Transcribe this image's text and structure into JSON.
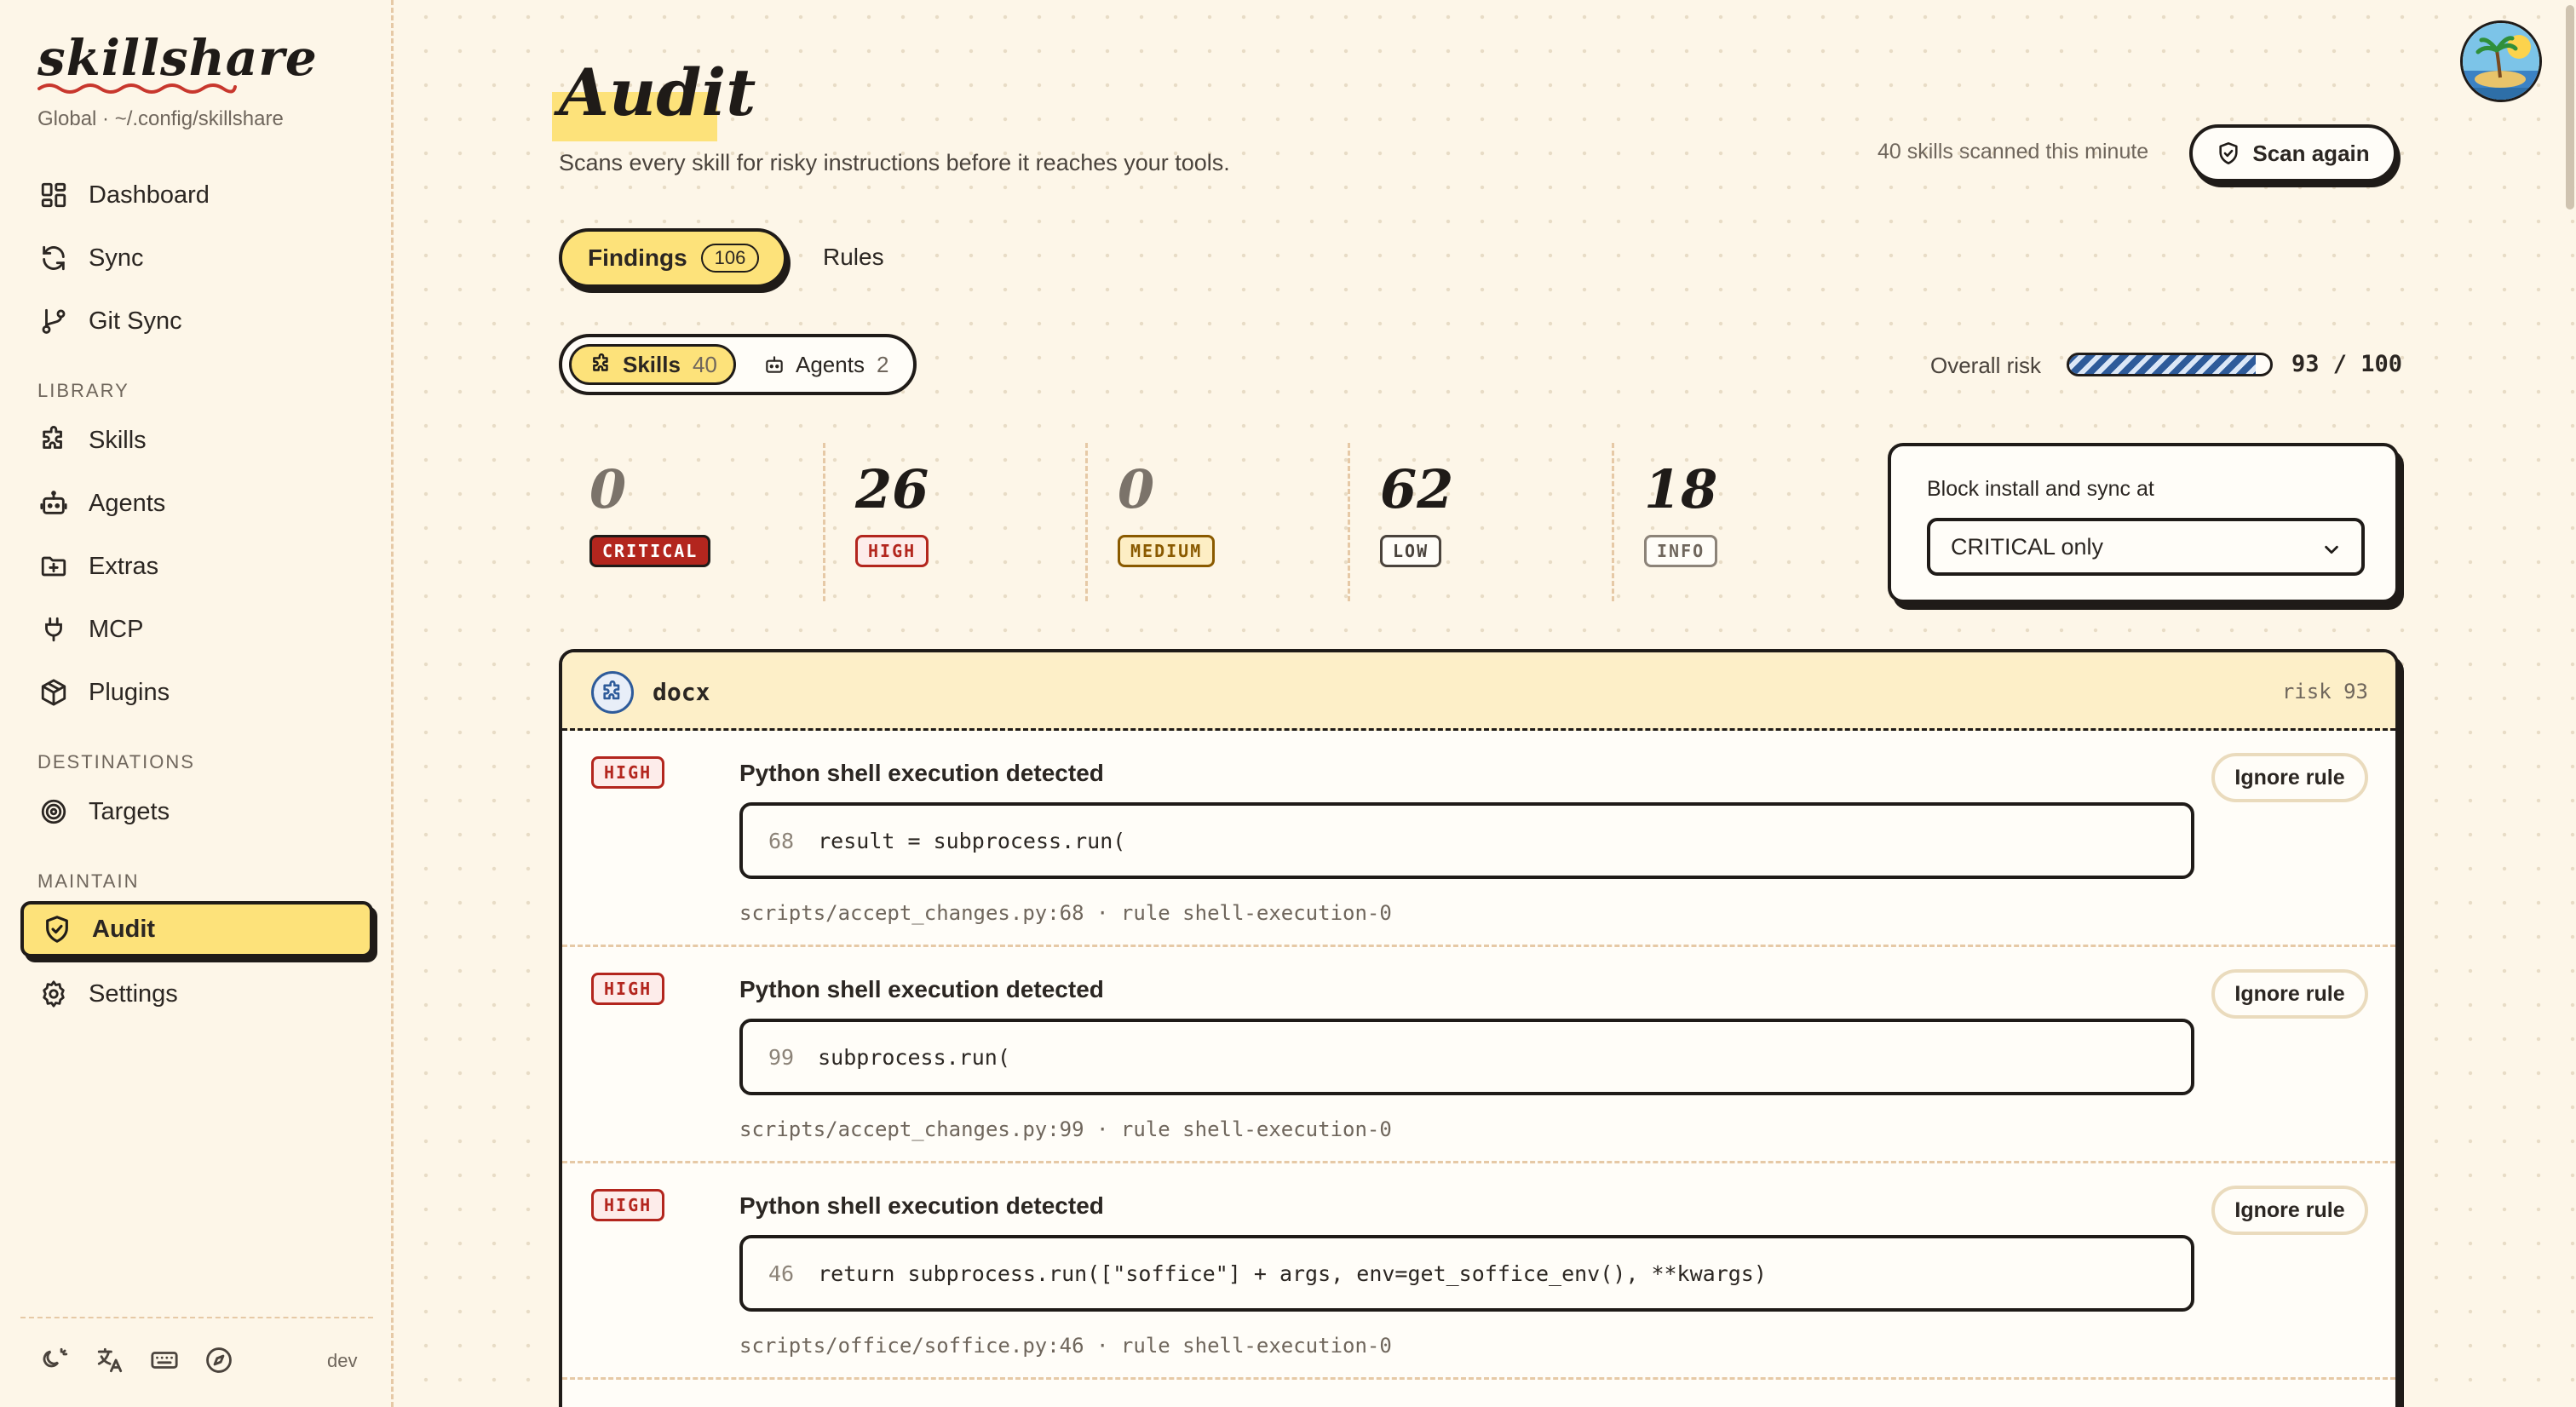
{
  "brand": {
    "name": "skillshare",
    "scope": "Global · ~/.config/skillshare"
  },
  "nav": {
    "dashboard": "Dashboard",
    "sync": "Sync",
    "git_sync": "Git Sync",
    "library_label": "LIBRARY",
    "skills": "Skills",
    "agents": "Agents",
    "extras": "Extras",
    "mcp": "MCP",
    "plugins": "Plugins",
    "destinations_label": "DESTINATIONS",
    "targets": "Targets",
    "maintain_label": "MAINTAIN",
    "audit": "Audit",
    "settings": "Settings",
    "active": "Audit"
  },
  "footer": {
    "env": "dev",
    "icons": [
      "theme-icon",
      "translate-icon",
      "keyboard-icon",
      "compass-icon"
    ]
  },
  "page": {
    "title": "Audit",
    "subtitle": "Scans every skill for risky instructions before it reaches your tools.",
    "scan_meta": "40 skills scanned this minute",
    "scan_button": "Scan again"
  },
  "tabs": {
    "findings": {
      "label": "Findings",
      "count": "106"
    },
    "rules": {
      "label": "Rules"
    }
  },
  "segment": {
    "skills": {
      "label": "Skills",
      "count": "40"
    },
    "agents": {
      "label": "Agents",
      "count": "2"
    }
  },
  "risk": {
    "label": "Overall risk",
    "value": 93,
    "max": 100,
    "text": "93 / 100"
  },
  "stats": [
    {
      "count": "0",
      "label": "CRITICAL"
    },
    {
      "count": "26",
      "label": "HIGH"
    },
    {
      "count": "0",
      "label": "MEDIUM"
    },
    {
      "count": "62",
      "label": "LOW"
    },
    {
      "count": "18",
      "label": "INFO"
    }
  ],
  "block": {
    "label": "Block install and sync at",
    "value": "CRITICAL only"
  },
  "group": {
    "name": "docx",
    "risk": "risk 93"
  },
  "findings": [
    {
      "severity": "HIGH",
      "title": "Python shell execution detected",
      "line": "68",
      "code": "result = subprocess.run(",
      "location": "scripts/accept_changes.py:68 · rule shell-execution-0",
      "action": "Ignore rule"
    },
    {
      "severity": "HIGH",
      "title": "Python shell execution detected",
      "line": "99",
      "code": "subprocess.run(",
      "location": "scripts/accept_changes.py:99 · rule shell-execution-0",
      "action": "Ignore rule"
    },
    {
      "severity": "HIGH",
      "title": "Python shell execution detected",
      "line": "46",
      "code": "return subprocess.run([\"soffice\"] + args, env=get_soffice_env(), **kwargs)",
      "location": "scripts/office/soffice.py:46 · rule shell-execution-0",
      "action": "Ignore rule"
    }
  ],
  "colors": {
    "accent": "#fde27a",
    "ink": "#1f1b18",
    "critical": "#b3261e",
    "background": "#fdf6e8",
    "risk_stripe": "#2e5b9a"
  }
}
